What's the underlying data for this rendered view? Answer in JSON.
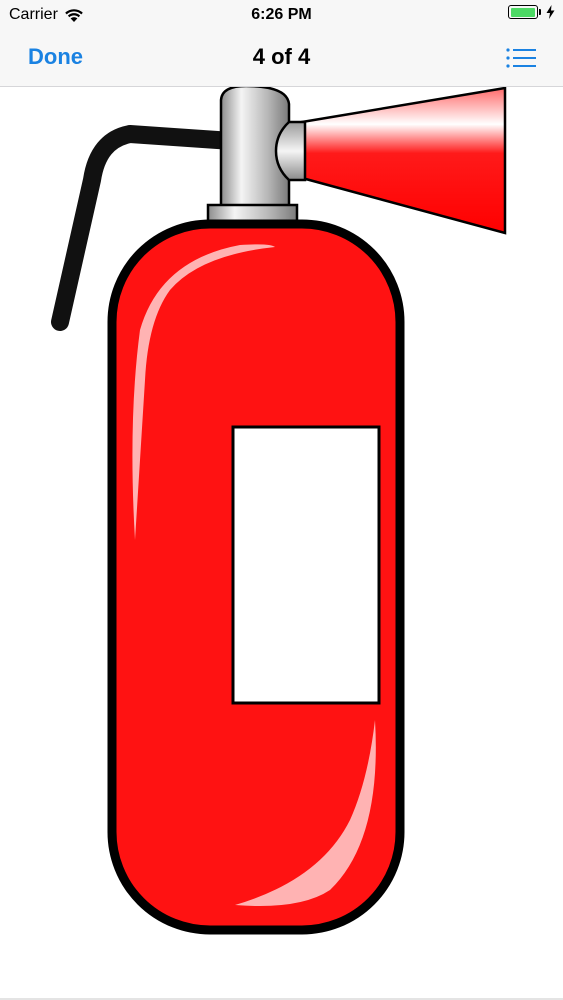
{
  "status_bar": {
    "carrier": "Carrier",
    "time": "6:26 PM",
    "wifi_icon": "wifi-icon",
    "battery_icon": "battery-icon",
    "charging_icon": "charging-bolt-icon",
    "battery_level": 1.0,
    "battery_color": "#4cd964"
  },
  "nav_bar": {
    "done_label": "Done",
    "title": "4 of 4",
    "list_icon": "list-icon",
    "accent_color": "#1a82e2"
  },
  "content": {
    "image_subject": "fire-extinguisher",
    "colors": {
      "body_red": "#ff1a1a",
      "outline": "#000000",
      "label": "#ffffff"
    }
  }
}
